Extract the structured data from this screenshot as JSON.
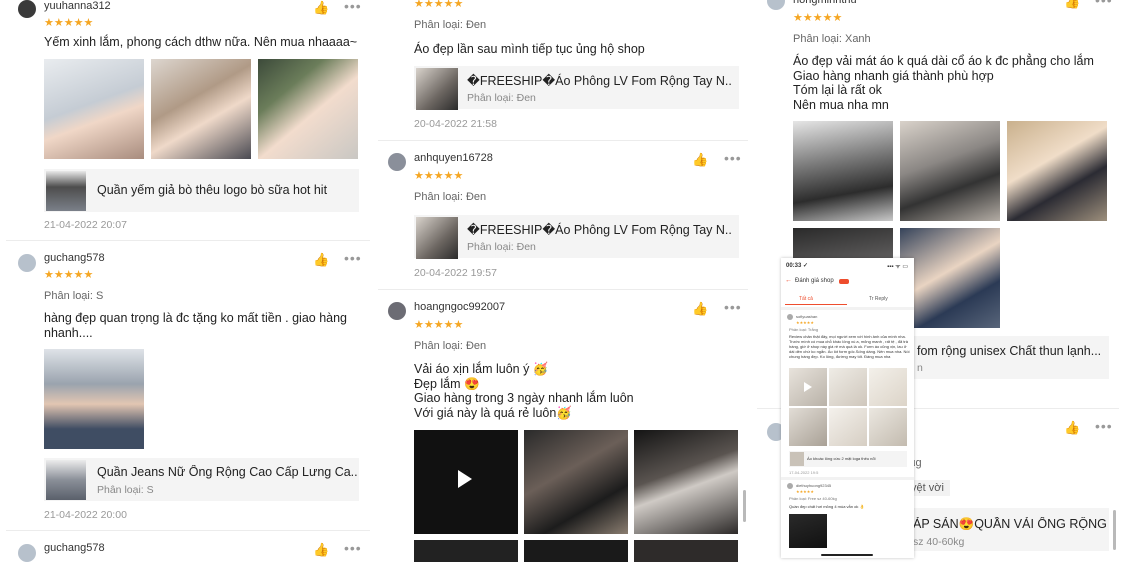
{
  "col1": {
    "r1": {
      "user": "yuuhanna312",
      "stars": "★★★★★",
      "comment": "Yếm xinh lắm, phong cách dthw nữa. Nên mua nhaaaa~",
      "product_title": "Quần yếm giả bò thêu logo bò sữa hot hit",
      "date": "21-04-2022 20:07"
    },
    "r2": {
      "user": "guchang578",
      "stars": "★★★★★",
      "variant": "Phân loại: S",
      "comment": "hàng đẹp quan trọng là đc tặng ko mất tiền . giao hàng nhanh....",
      "product_title": "Quần Jeans Nữ Ống Rộng Cao Cấp Lưng Ca...",
      "product_variant": "Phân loại: S",
      "date": "21-04-2022 20:00"
    },
    "r3": {
      "user": "guchang578"
    }
  },
  "col2": {
    "r1": {
      "stars": "★★★★★",
      "variant": "Phân loại: Đen",
      "comment": "Áo đẹp lần sau mình tiếp tục ủng hộ shop",
      "product_title": "�FREESHIP�Áo Phông LV Fom Rộng Tay N...",
      "product_variant": "Phân loại: Đen",
      "date": "20-04-2022 21:58"
    },
    "r2": {
      "user": "anhquyen16728",
      "stars": "★★★★★",
      "variant": "Phân loại: Đen",
      "product_title": "�FREESHIP�Áo Phông LV Fom Rộng Tay N...",
      "product_variant": "Phân loại: Đen",
      "date": "20-04-2022 19:57"
    },
    "r3": {
      "user": "hoangngoc992007",
      "stars": "★★★★★",
      "variant": "Phân loại: Đen",
      "comment": "Vải áo xịn lắm luôn ý 🥳\nĐẹp lắm 😍\nGiao hàng trong 3 ngày nhanh lắm luôn\nVới giá này là quá rẻ luôn🥳"
    }
  },
  "col3": {
    "r1": {
      "user": "hongminhthu",
      "stars": "★★★★★",
      "variant": "Phân loại: Xanh",
      "comment": "Áo đẹp vải mát áo k quá dài cổ áo k đc phẳng cho lắm\nGiao hàng nhanh giá thành phù hợp\nTóm lại là rất ok\nNên mua nha mn",
      "product_title": "fom rộng unisex Chất thun lạnh...",
      "product_variant": "n"
    },
    "r2": {
      "variant_partial": "ιg",
      "comment_partial": "yệt vời",
      "product_title": "ẢP SẢN😍QUẦN VẢI ỐNG RỘNG",
      "product_variant": "sz 40-60kg"
    }
  },
  "phone": {
    "time": "00:33 ✓",
    "status": "▪▪▪ ᯤ ▭",
    "header": "Đánh giá shop",
    "tab_all": "Tất cả",
    "tab_reply": "Tr Reply",
    "user1": "sofiyuashan",
    "variant1": "Phân loại: Trắng",
    "text1": "Review chân thật đây, mọi người xem với hình ảnh của mình nha. Trước mình có mua chỗ khác lông xù a, mỏng manh , rất tệ , đã trả hàng, giờ ở shop này giá rẻ mà quá là ok. Form áo cũng xịn, lau ở dài dẻn chứ ko ngắn. Áo lót form gốc.Sống dáng. Nên mua nha. Nói chung hàng đẹp. Ko lông, đường may tốt. Đáng mua nha",
    "product1": "Áo khoác lông cừu 2 mặt loga thêu nổi",
    "date1": "17-04-2022 19:5",
    "user2": "diethuyhuong92345",
    "variant2": "Phân loại: Free sz 40-60kg",
    "text2": "Quần đẹp chất hơi mỏng 4 mùa vẫn ok 👌"
  },
  "icons": {
    "like": "thumbs-up-icon",
    "more": "more-dots-icon",
    "star": "star-icon"
  },
  "colors": {
    "star": "#f5a623",
    "muted": "#999999",
    "product_bg": "#f4f4f4",
    "shopee_orange": "#ee4d2d"
  }
}
